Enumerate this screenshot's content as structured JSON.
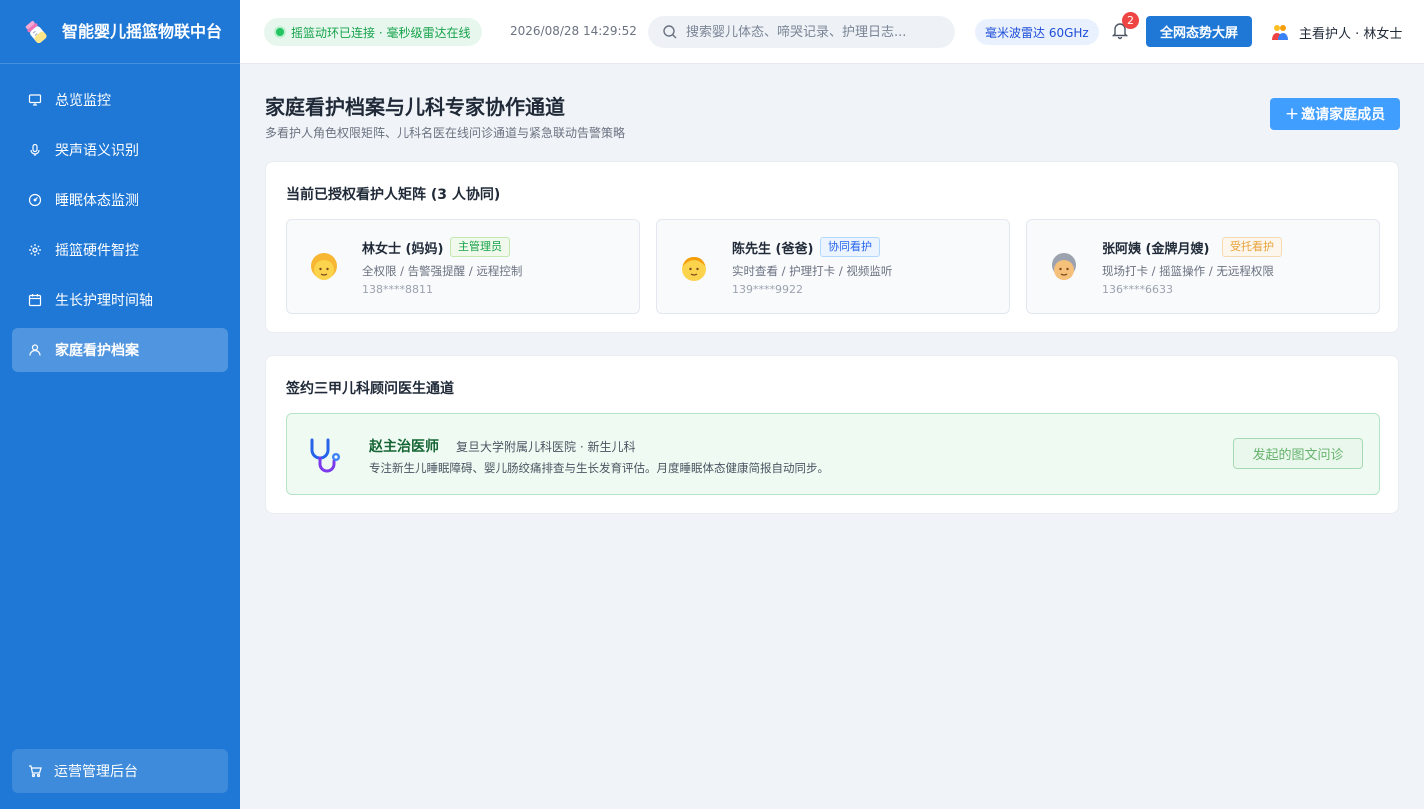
{
  "app": {
    "title": "智能婴儿摇篮物联中台"
  },
  "sidebar": {
    "items": [
      {
        "label": "总览监控",
        "icon": "monitor-icon",
        "active": false
      },
      {
        "label": "哭声语义识别",
        "icon": "mic-icon",
        "active": false
      },
      {
        "label": "睡眠体态监测",
        "icon": "gauge-icon",
        "active": false
      },
      {
        "label": "摇篮硬件智控",
        "icon": "gear-icon",
        "active": false
      },
      {
        "label": "生长护理时间轴",
        "icon": "calendar-icon",
        "active": false
      },
      {
        "label": "家庭看护档案",
        "icon": "user-icon",
        "active": true
      }
    ],
    "footer": {
      "label": "运营管理后台",
      "icon": "cart-icon"
    }
  },
  "header": {
    "status": "摇篮动环已连接 · 毫秒级雷达在线",
    "datetime": "2026/08/28 14:29:52",
    "search_placeholder": "搜索婴儿体态、啼哭记录、护理日志...",
    "radar_badge": "毫米波雷达 60GHz",
    "notification_count": "2",
    "big_screen_button": "全网态势大屏",
    "user_label": "主看护人 · 林女士"
  },
  "main": {
    "title": "家庭看护档案与儿科专家协作通道",
    "subtitle": "多看护人角色权限矩阵、儿科名医在线问诊通道与紧急联动告警策略",
    "invite_button": "邀请家庭成员",
    "guardians_section": {
      "title": "当前已授权看护人矩阵 (3 人协同)",
      "guardians": [
        {
          "name": "林女士 (妈妈)",
          "tag": "主管理员",
          "permissions": "全权限 / 告警强提醒 / 远程控制",
          "phone": "138****8811",
          "avatar": "woman-avatar-icon"
        },
        {
          "name": "陈先生 (爸爸)",
          "tag": "协同看护",
          "permissions": "实时查看 / 护理打卡 / 视频监听",
          "phone": "139****9922",
          "avatar": "man-avatar-icon"
        },
        {
          "name": "张阿姨 (金牌月嫂)",
          "tag": "受托看护",
          "permissions": "现场打卡 / 摇篮操作 / 无远程权限",
          "phone": "136****6633",
          "avatar": "elder-woman-avatar-icon"
        }
      ]
    },
    "doctor_section": {
      "title": "签约三甲儿科顾问医生通道",
      "doctor": {
        "name": "赵主治医师",
        "hospital": "复旦大学附属儿科医院 · 新生儿科",
        "description": "专注新生儿睡眠障碍、婴儿肠绞痛排查与生长发育评估。月度睡眠体态健康简报自动同步。",
        "consult_button": "发起的图文问诊"
      }
    }
  },
  "colors": {
    "sidebar_bg": "#1f78d6",
    "accent": "#409eff",
    "success": "#16a34a"
  }
}
